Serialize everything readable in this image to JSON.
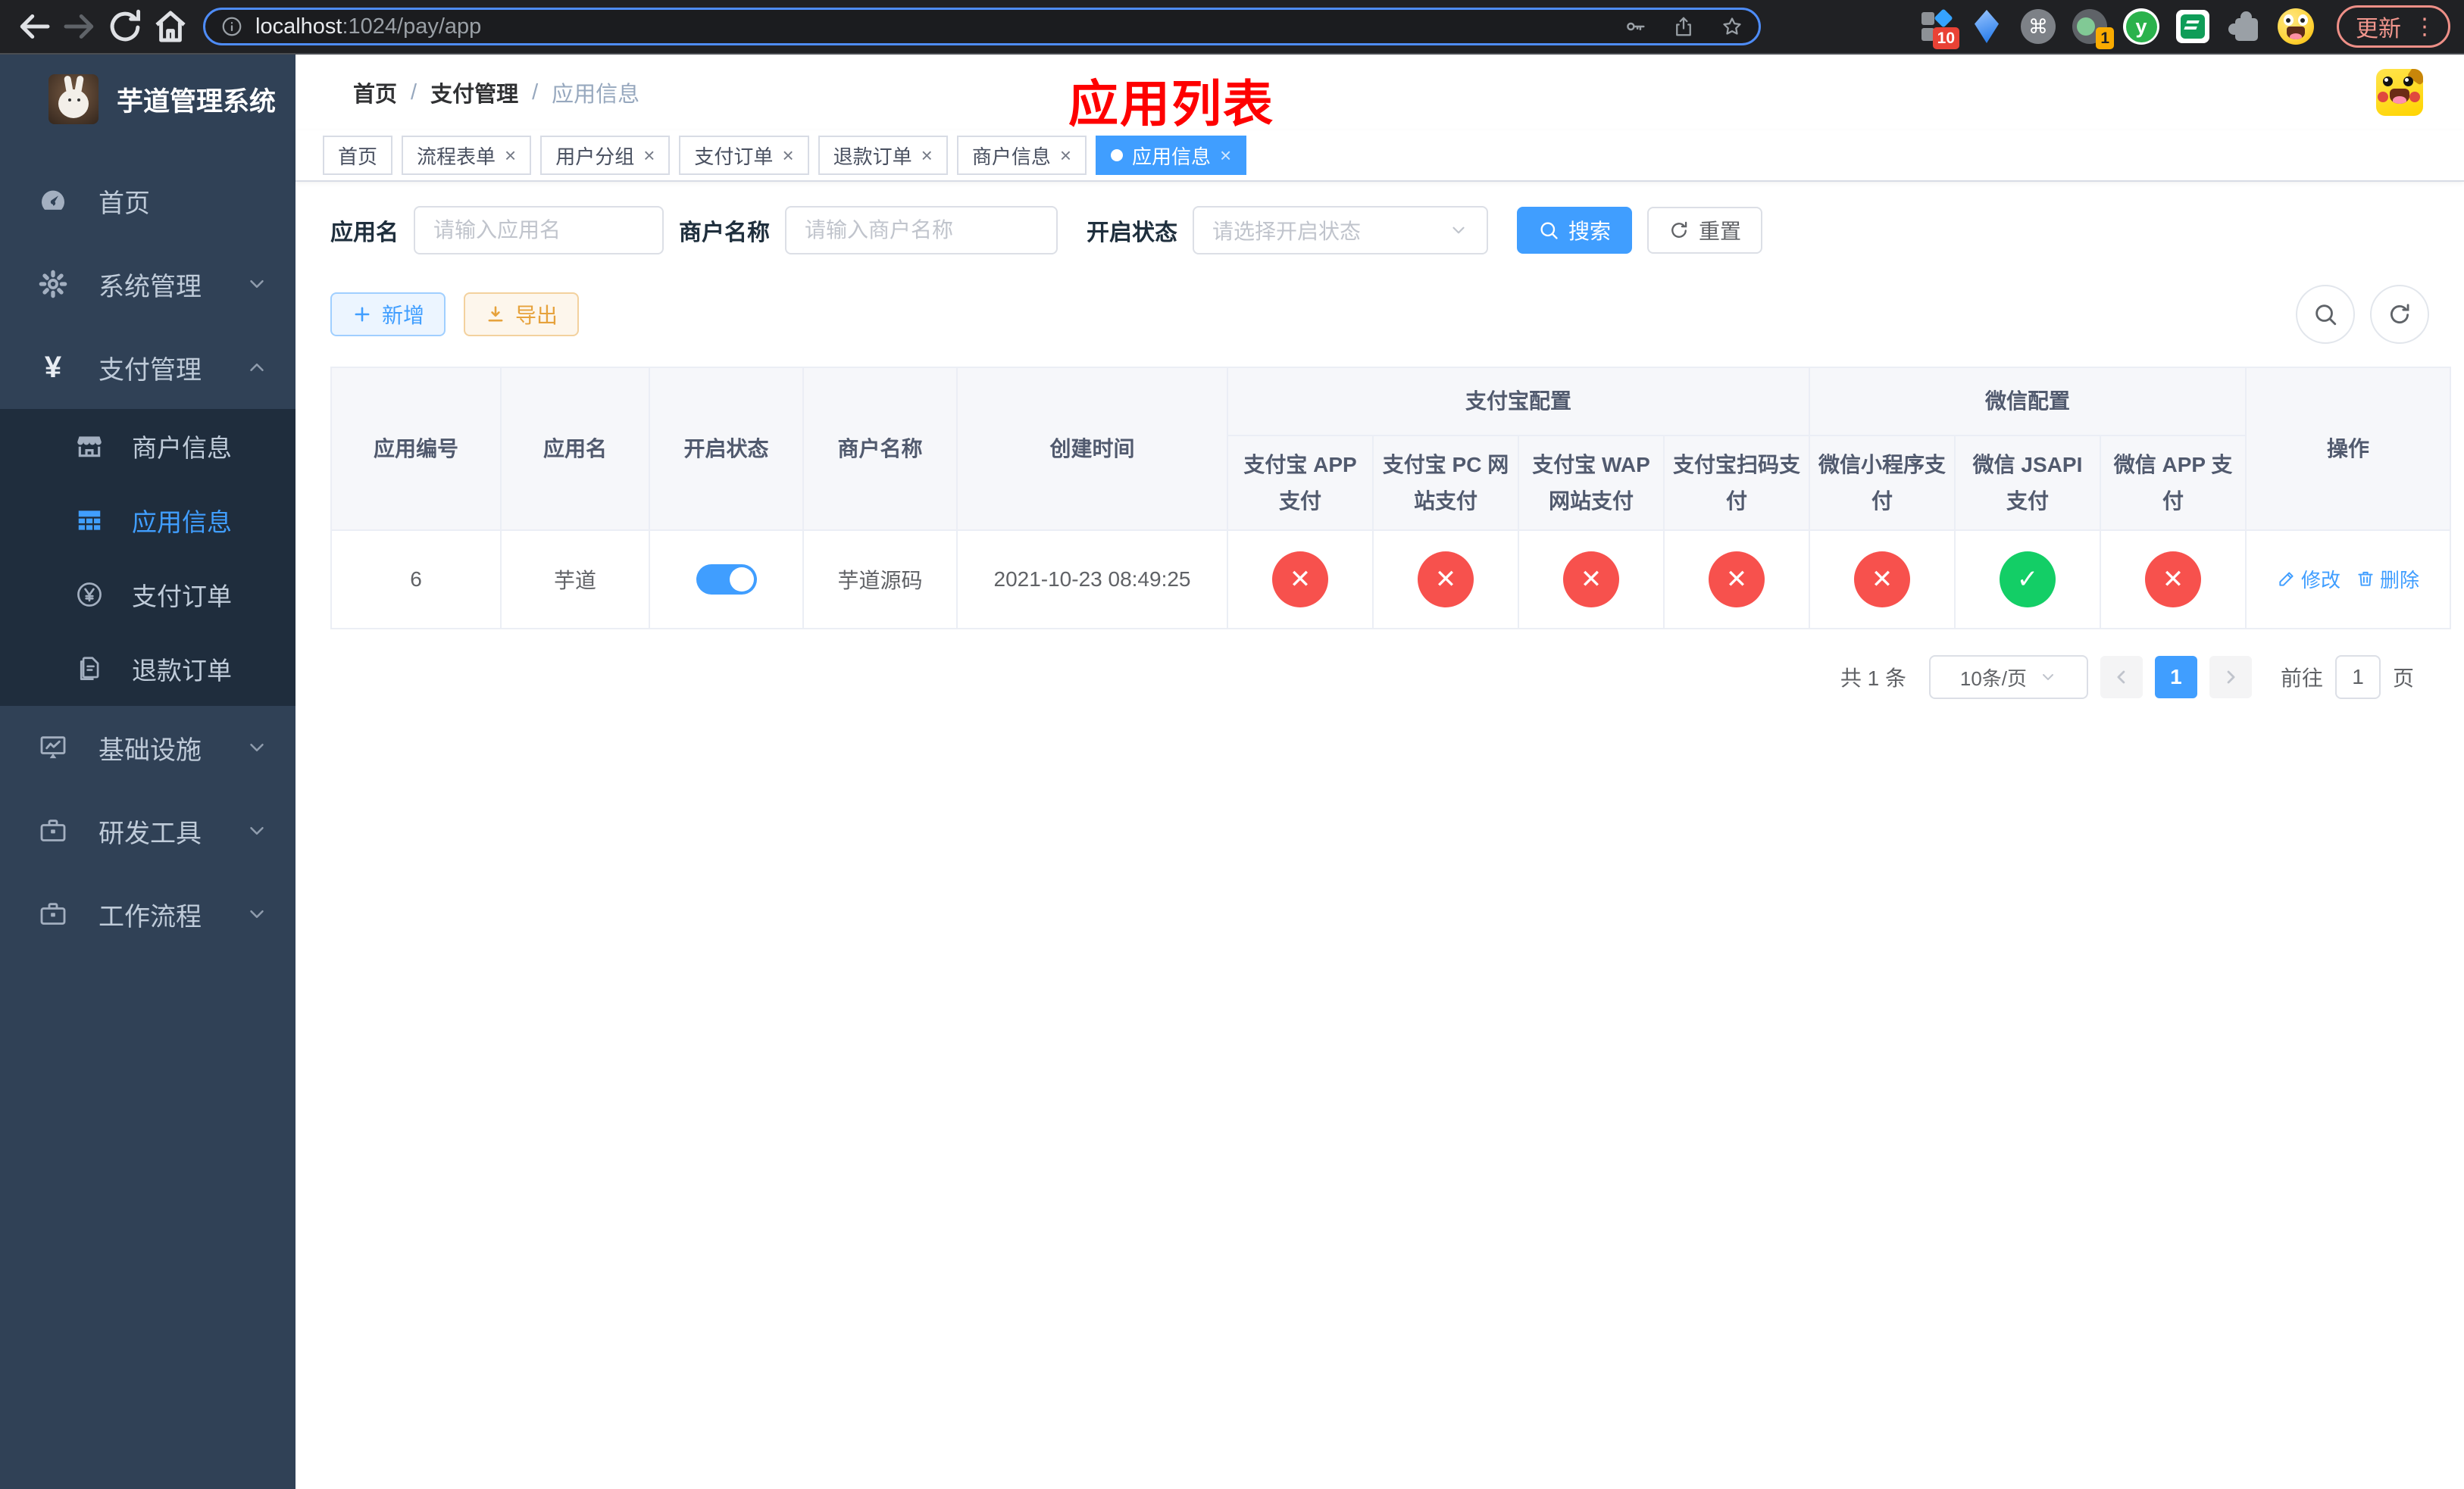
{
  "browser": {
    "url_host": "localhost",
    "url_path": ":1024/pay/app",
    "update_label": "更新",
    "ext_badge_blocks": "10",
    "ext_badge_camera": "1",
    "ext_yudao_letter": "y",
    "command_glyph": "⌘"
  },
  "sidebar": {
    "title": "芋道管理系统",
    "items": [
      {
        "label": "首页",
        "icon": "gauge-icon"
      },
      {
        "label": "系统管理",
        "icon": "gear-icon",
        "caret": "down"
      },
      {
        "label": "支付管理",
        "icon": "yen-icon",
        "caret": "up",
        "submenu": [
          {
            "label": "商户信息",
            "icon": "store-icon"
          },
          {
            "label": "应用信息",
            "icon": "grid-icon",
            "active": true
          },
          {
            "label": "支付订单",
            "icon": "coin-icon"
          },
          {
            "label": "退款订单",
            "icon": "document-icon"
          }
        ]
      },
      {
        "label": "基础设施",
        "icon": "monitor-icon",
        "caret": "down"
      },
      {
        "label": "研发工具",
        "icon": "briefcase-icon",
        "caret": "down"
      },
      {
        "label": "工作流程",
        "icon": "briefcase-icon",
        "caret": "down"
      }
    ]
  },
  "header": {
    "breadcrumb": [
      "首页",
      "支付管理",
      "应用信息"
    ],
    "overlay_title": "应用列表"
  },
  "tabs": {
    "items": [
      {
        "label": "首页",
        "closable": false
      },
      {
        "label": "流程表单",
        "closable": true
      },
      {
        "label": "用户分组",
        "closable": true
      },
      {
        "label": "支付订单",
        "closable": true
      },
      {
        "label": "退款订单",
        "closable": true
      },
      {
        "label": "商户信息",
        "closable": true
      },
      {
        "label": "应用信息",
        "closable": true,
        "active": true
      }
    ]
  },
  "filters": {
    "app_name_label": "应用名",
    "app_name_placeholder": "请输入应用名",
    "merchant_label": "商户名称",
    "merchant_placeholder": "请输入商户名称",
    "status_label": "开启状态",
    "status_placeholder": "请选择开启状态",
    "search_label": "搜索",
    "reset_label": "重置"
  },
  "toolbar": {
    "add_label": "新增",
    "export_label": "导出"
  },
  "table": {
    "main_columns": [
      "应用编号",
      "应用名",
      "开启状态",
      "商户名称",
      "创建时间"
    ],
    "groups": [
      {
        "label": "支付宝配置",
        "children": [
          "支付宝 APP 支付",
          "支付宝 PC 网站支付",
          "支付宝 WAP 网站支付",
          "支付宝扫码支付"
        ]
      },
      {
        "label": "微信配置",
        "children": [
          "微信小程序支付",
          "微信 JSAPI 支付",
          "微信 APP 支付"
        ]
      }
    ],
    "action_column": "操作",
    "rows": [
      {
        "id": "6",
        "name": "芋道",
        "enabled": true,
        "merchant": "芋道源码",
        "created": "2021-10-23 08:49:25",
        "statuses": [
          false,
          false,
          false,
          false,
          false,
          true,
          false
        ],
        "edit_label": "修改",
        "delete_label": "删除"
      }
    ]
  },
  "pagination": {
    "total": "共 1 条",
    "page_size": "10条/页",
    "page": "1",
    "goto_prefix": "前往",
    "goto_value": "1",
    "goto_suffix": "页"
  },
  "colors": {
    "primary": "#409EFF",
    "sidebar_bg": "#304156",
    "submenu_bg": "#1f2d3d",
    "status_off": "#f7514d",
    "status_on": "#13ce66",
    "annotation_red": "#fe0000",
    "export_orange": "#e6a23c"
  }
}
